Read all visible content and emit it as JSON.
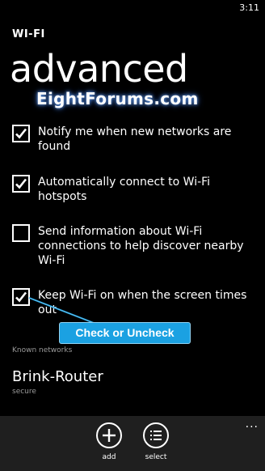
{
  "status": {
    "time": "3:11"
  },
  "header": {
    "app_title": "WI-FI",
    "page_title": "advanced"
  },
  "watermark": "EightForums.com",
  "options": [
    {
      "label": "Notify me when new networks are found",
      "checked": true
    },
    {
      "label": "Automatically connect to Wi-Fi hotspots",
      "checked": true
    },
    {
      "label": "Send information about Wi-Fi connections to help discover nearby Wi-Fi",
      "checked": false
    },
    {
      "label": "Keep Wi-Fi on when the screen times out",
      "checked": true
    }
  ],
  "callout": "Check or Uncheck",
  "known_networks": {
    "section_label": "Known networks",
    "items": [
      {
        "name": "Brink-Router",
        "status": "secure"
      }
    ]
  },
  "app_bar": {
    "more": "...",
    "buttons": [
      {
        "label": "add",
        "icon": "plus-icon"
      },
      {
        "label": "select",
        "icon": "list-select-icon"
      }
    ]
  },
  "colors": {
    "accent": "#1ba1e2",
    "background": "#000000",
    "app_bar": "#1f1f1f"
  }
}
